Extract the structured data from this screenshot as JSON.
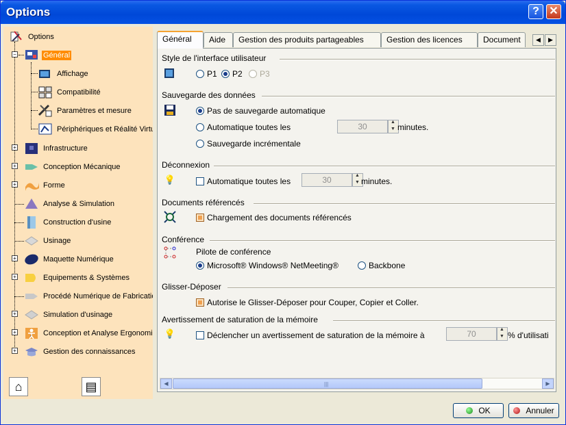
{
  "window": {
    "title": "Options"
  },
  "tree": {
    "root": "Options",
    "items": [
      {
        "label": "Général",
        "selected": true
      },
      {
        "label": "Affichage"
      },
      {
        "label": "Compatibilité"
      },
      {
        "label": "Paramètres et mesure"
      },
      {
        "label": "Périphériques et Réalité Virtue"
      },
      {
        "label": "Infrastructure"
      },
      {
        "label": "Conception Mécanique"
      },
      {
        "label": "Forme"
      },
      {
        "label": "Analyse & Simulation"
      },
      {
        "label": "Construction d'usine"
      },
      {
        "label": "Usinage"
      },
      {
        "label": "Maquette Numérique"
      },
      {
        "label": "Equipements & Systèmes"
      },
      {
        "label": "Procédé Numérique de Fabrication"
      },
      {
        "label": "Simulation d'usinage"
      },
      {
        "label": "Conception et Analyse Ergonomiq"
      },
      {
        "label": "Gestion des connaissances"
      }
    ]
  },
  "tabs": [
    "Général",
    "Aide",
    "Gestion des produits partageables",
    "Gestion des licences",
    "Document"
  ],
  "sections": {
    "style": {
      "title": "Style de l'interface utilisateur",
      "options": [
        "P1",
        "P2",
        "P3"
      ],
      "selected": "P2"
    },
    "save": {
      "title": "Sauvegarde des données",
      "opt1": "Pas de sauvegarde automatique",
      "opt2": "Automatique toutes les",
      "opt2_value": "30",
      "opt2_unit": "minutes.",
      "opt3": "Sauvegarde incrémentale"
    },
    "disconnect": {
      "title": "Déconnexion",
      "label": "Automatique toutes les",
      "value": "30",
      "unit": "minutes."
    },
    "docs": {
      "title": "Documents référencés",
      "label": "Chargement des documents référencés"
    },
    "conference": {
      "title": "Conférence",
      "driver_label": "Pilote de conférence",
      "opt1": "Microsoft® Windows® NetMeeting®",
      "opt2": "Backbone"
    },
    "dragdrop": {
      "title": "Glisser-Déposer",
      "label": "Autorise le Glisser-Déposer pour Couper, Copier et Coller."
    },
    "memory": {
      "title": "Avertissement de saturation de la mémoire",
      "label": "Déclencher un avertissement de saturation de la mémoire à",
      "value": "70",
      "unit": "% d'utilisati"
    }
  },
  "buttons": {
    "ok": "OK",
    "cancel": "Annuler"
  },
  "colors": {
    "accent": "#ff8c00",
    "tree_bg": "#fde3bc",
    "title_bar": "#0048d8"
  }
}
